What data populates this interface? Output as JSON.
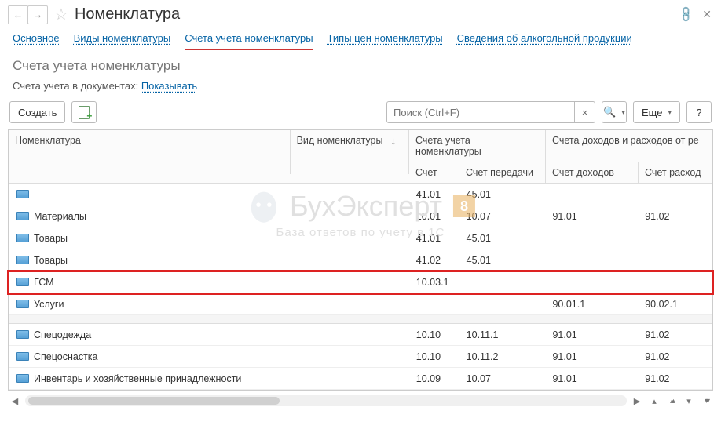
{
  "header": {
    "title": "Номенклатура"
  },
  "tabs": [
    {
      "label": "Основное"
    },
    {
      "label": "Виды номенклатуры"
    },
    {
      "label": "Счета учета номенклатуры",
      "active": true
    },
    {
      "label": "Типы цен номенклатуры"
    },
    {
      "label": "Сведения об алкогольной продукции"
    }
  ],
  "section": {
    "title": "Счета учета номенклатуры",
    "sub_label": "Счета учета в документах:",
    "sub_link": "Показывать"
  },
  "toolbar": {
    "create": "Создать",
    "more": "Еще",
    "help": "?"
  },
  "search": {
    "placeholder": "Поиск (Ctrl+F)"
  },
  "columns": {
    "name": "Номенклатура",
    "kind": "Вид номенклатуры",
    "group_accounts": "Счета учета номенклатуры",
    "group_income": "Счета доходов и расходов от ре",
    "acc": "Счет",
    "acc_transfer": "Счет передачи",
    "acc_income": "Счет доходов",
    "acc_expense": "Счет расход"
  },
  "rows_top": [
    {
      "name": "",
      "acc": "41.01",
      "transfer": "45.01",
      "income": "",
      "expense": ""
    },
    {
      "name": "Материалы",
      "acc": "10.01",
      "transfer": "10.07",
      "income": "91.01",
      "expense": "91.02"
    },
    {
      "name": "Товары",
      "acc": "41.01",
      "transfer": "45.01",
      "income": "",
      "expense": ""
    },
    {
      "name": "Товары",
      "acc": "41.02",
      "transfer": "45.01",
      "income": "",
      "expense": ""
    },
    {
      "name": "ГСМ",
      "acc": "10.03.1",
      "transfer": "",
      "income": "",
      "expense": "",
      "highlight": true
    },
    {
      "name": "Услуги",
      "acc": "",
      "transfer": "",
      "income": "90.01.1",
      "expense": "90.02.1"
    }
  ],
  "rows_bottom": [
    {
      "name": "Спецодежда",
      "acc": "10.10",
      "transfer": "10.11.1",
      "income": "91.01",
      "expense": "91.02"
    },
    {
      "name": "Спецоснастка",
      "acc": "10.10",
      "transfer": "10.11.2",
      "income": "91.01",
      "expense": "91.02"
    },
    {
      "name": "Инвентарь и хозяйственные принадлежности",
      "acc": "10.09",
      "transfer": "10.07",
      "income": "91.01",
      "expense": "91.02"
    }
  ],
  "watermark": {
    "main": "БухЭксперт",
    "eight": "8",
    "sub": "База ответов по учету в 1С"
  }
}
